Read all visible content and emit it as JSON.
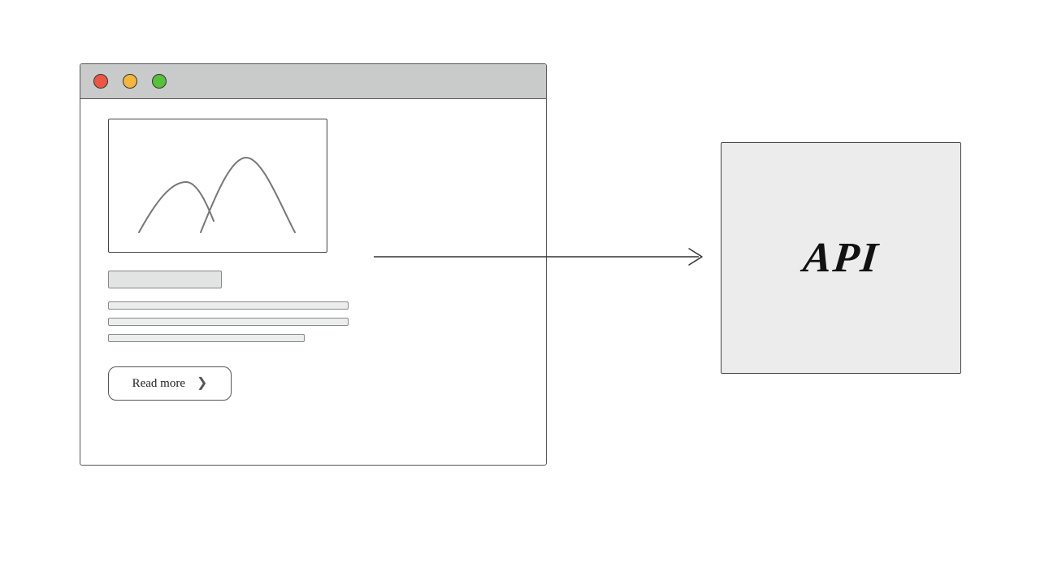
{
  "browser": {
    "traffic_lights": [
      "close",
      "minimize",
      "zoom"
    ],
    "hero_icon": "mountains-image-placeholder",
    "read_more_label": "Read more"
  },
  "arrow": {
    "direction": "right"
  },
  "api_box": {
    "label": "API"
  }
}
